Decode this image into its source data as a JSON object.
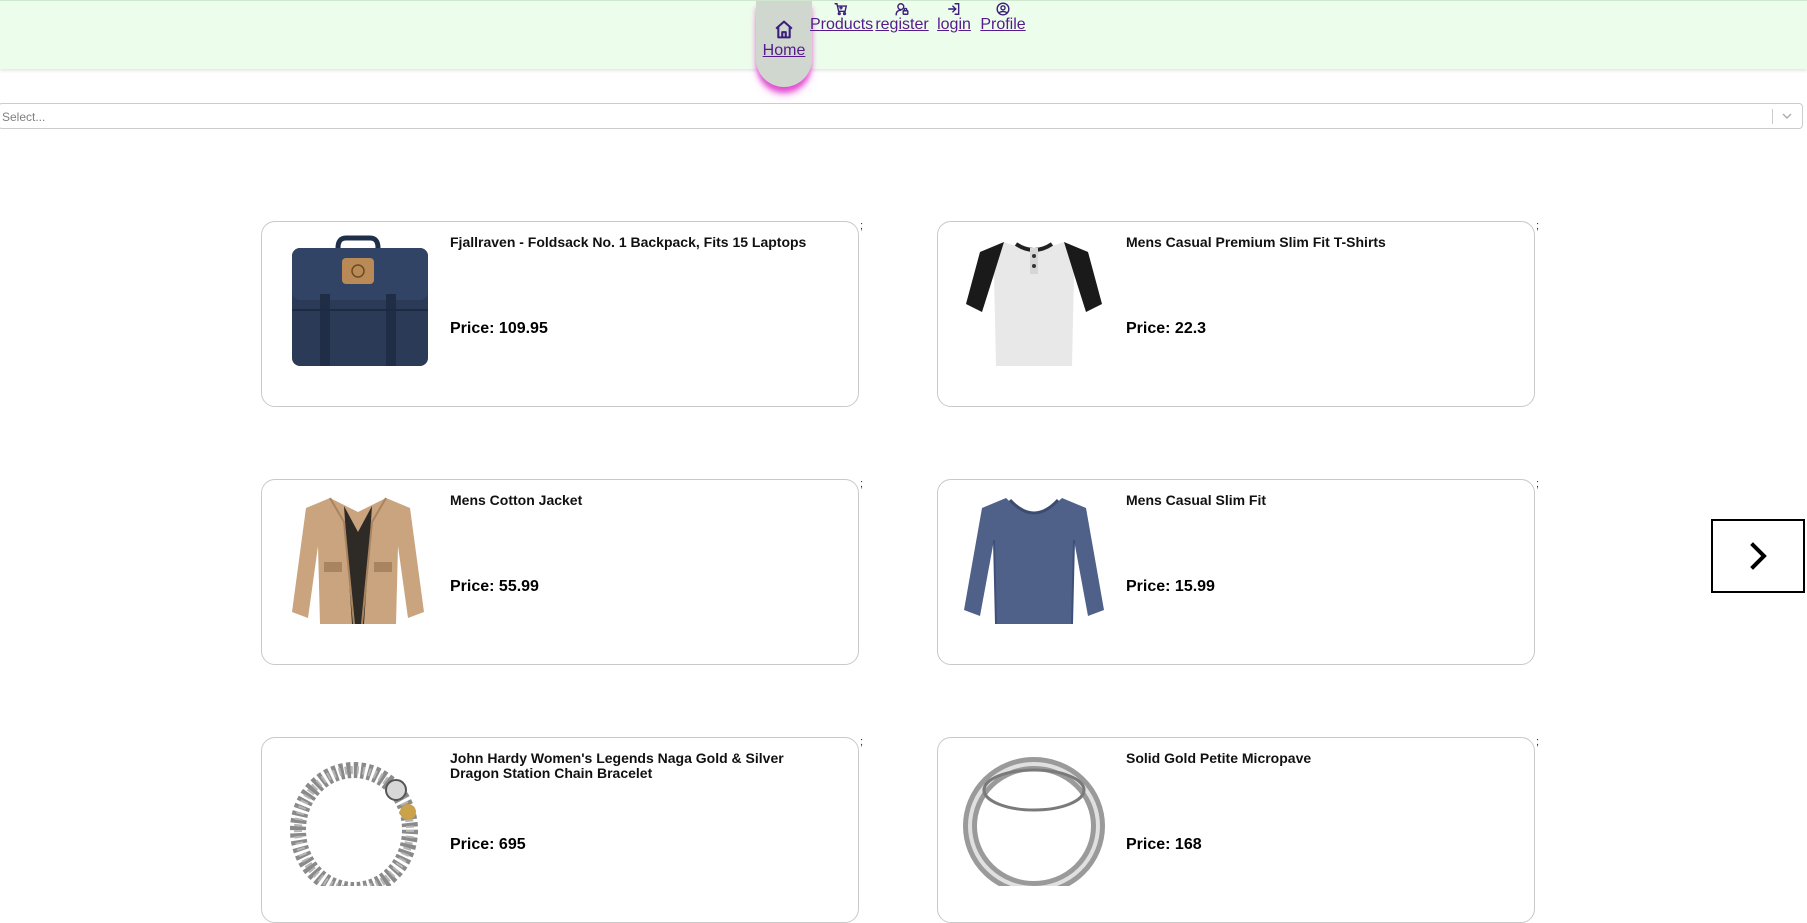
{
  "nav": {
    "items": [
      {
        "label": "Home",
        "icon": "home-icon"
      },
      {
        "label": "Products",
        "icon": "cart-icon"
      },
      {
        "label": "register",
        "icon": "user-lock-icon"
      },
      {
        "label": "login",
        "icon": "login-icon"
      },
      {
        "label": "Profile",
        "icon": "user-circle-icon"
      }
    ],
    "active": "Home",
    "colors": {
      "bar": "#edfdec",
      "link": "#551a8b",
      "active_glow": "#e24bd2"
    }
  },
  "filter": {
    "placeholder": "Select...",
    "icon": "chevron-down-icon"
  },
  "products": [
    {
      "title": "Fjallraven - Foldsack No. 1 Backpack, Fits 15 Laptops",
      "price": "Price: 109.95",
      "semicolon": ";",
      "image": "backpack"
    },
    {
      "title": "Mens Casual Premium Slim Fit T-Shirts",
      "price": "Price: 22.3",
      "semicolon": ";",
      "image": "tshirt"
    },
    {
      "title": "Mens Cotton Jacket",
      "price": "Price: 55.99",
      "semicolon": ";",
      "image": "jacket"
    },
    {
      "title": "Mens Casual Slim Fit",
      "price": "Price: 15.99",
      "semicolon": ";",
      "image": "longsleeve"
    },
    {
      "title": "John Hardy Women's Legends Naga Gold & Silver Dragon Station Chain Bracelet",
      "price": "Price: 695",
      "semicolon": ";",
      "image": "bracelet"
    },
    {
      "title": "Solid Gold Petite Micropave",
      "price": "Price: 168",
      "semicolon": ";",
      "image": "ring"
    }
  ],
  "carousel": {
    "next_icon": "chevron-right-icon"
  }
}
